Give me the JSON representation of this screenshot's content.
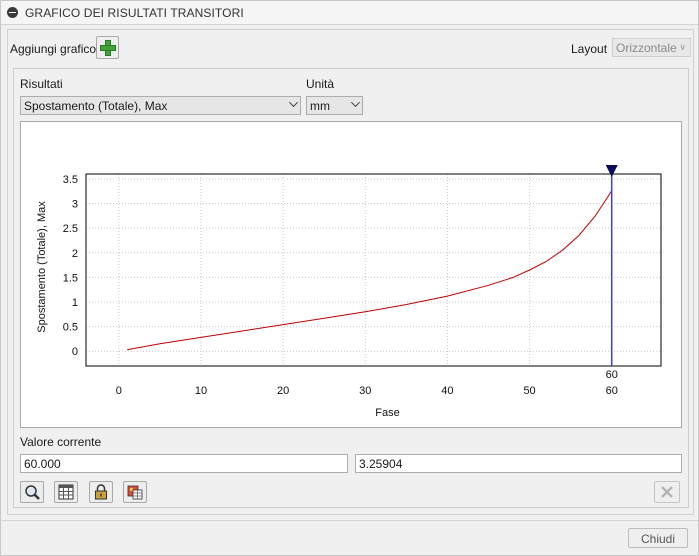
{
  "window": {
    "title": "GRAFICO DEI RISULTATI TRANSITORI"
  },
  "toolbar": {
    "add_chart_label": "Aggiungi grafico",
    "layout_label": "Layout",
    "layout_value": "Orizzontale"
  },
  "results": {
    "label": "Risultati",
    "selected": "Spostamento (Totale), Max"
  },
  "units": {
    "label": "Unità",
    "selected": "mm"
  },
  "current_value": {
    "label": "Valore corrente",
    "x_value": "60.000",
    "y_value": "3.25904"
  },
  "icons": {
    "add": "plus-icon",
    "zoom": "magnifier-icon",
    "table": "table-icon",
    "lock": "lock-icon",
    "export": "export-icon",
    "delete": "close-icon",
    "collapse": "collapse-icon"
  },
  "footer": {
    "close_label": "Chiudi"
  },
  "colors": {
    "series": "#c00000",
    "cursor_line": "#3a3aff",
    "cursor_marker": "#0b0b5c"
  },
  "chart_data": {
    "type": "line",
    "xlabel": "Fase",
    "ylabel": "Spostamento (Totale), Max",
    "xlim": [
      -4,
      66
    ],
    "ylim": [
      -0.3,
      3.6
    ],
    "x_ticks": [
      0,
      10,
      20,
      30,
      40,
      50,
      60
    ],
    "y_ticks": [
      0,
      0.5,
      1,
      1.5,
      2,
      2.5,
      3,
      3.5
    ],
    "x_tick_labels": [
      "0",
      "10",
      "20",
      "30",
      "40",
      "50",
      "60"
    ],
    "y_tick_labels": [
      "0",
      "0.5",
      "1",
      "1.5",
      "2",
      "2.5",
      "3",
      "3.5"
    ],
    "grid": true,
    "cursor": {
      "x": 60,
      "label": "60"
    },
    "series": [
      {
        "x": [
          1,
          5,
          10,
          15,
          20,
          25,
          30,
          35,
          40,
          45,
          48,
          50,
          52,
          54,
          56,
          58,
          59,
          60
        ],
        "values": [
          0.03,
          0.15,
          0.28,
          0.41,
          0.54,
          0.67,
          0.8,
          0.95,
          1.12,
          1.34,
          1.5,
          1.65,
          1.82,
          2.05,
          2.35,
          2.75,
          3.0,
          3.26
        ]
      }
    ]
  }
}
